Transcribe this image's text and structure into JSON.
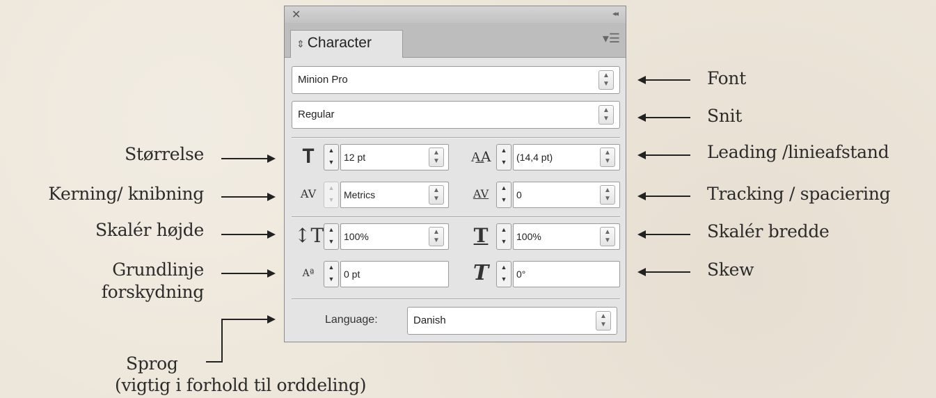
{
  "panel": {
    "tab_title": "Character",
    "font_family": "Minion Pro",
    "font_style": "Regular",
    "size": "12 pt",
    "leading": "(14,4 pt)",
    "kerning": "Metrics",
    "tracking": "0",
    "vertical_scale": "100%",
    "horizontal_scale": "100%",
    "baseline_shift": "0 pt",
    "skew": "0°",
    "language_label": "Language:",
    "language": "Danish"
  },
  "annotations_left": {
    "size": "Størrelse",
    "kerning": "Kerning/ knibning",
    "vscale": "Skalér højde",
    "baseline_1": "Grundlinje",
    "baseline_2": "forskydning",
    "language_1": "Sprog",
    "language_2": "(vigtig i forhold til orddeling)"
  },
  "annotations_right": {
    "font": "Font",
    "style": "Snit",
    "leading": "Leading /linieafstand",
    "tracking": "Tracking / spaciering",
    "hscale": "Skalér bredde",
    "skew": "Skew"
  }
}
